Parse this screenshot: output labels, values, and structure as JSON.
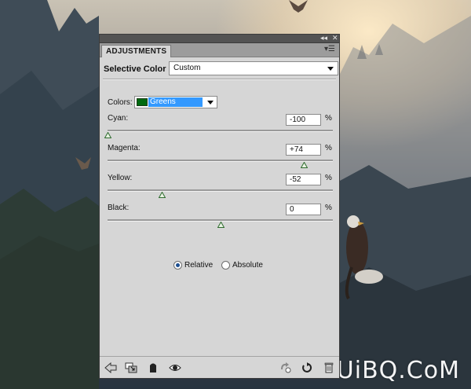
{
  "panel": {
    "tab_label": "ADJUSTMENTS",
    "adjustment_name": "Selective Color",
    "preset_value": "Custom",
    "colors_label": "Colors:",
    "colors_value": "Greens",
    "colors_swatch": "#006a10",
    "percent_symbol": "%",
    "sliders": [
      {
        "label": "Cyan:",
        "value": "-100",
        "level": -100
      },
      {
        "label": "Magenta:",
        "value": "+74",
        "level": 74
      },
      {
        "label": "Yellow:",
        "value": "-52",
        "level": -52
      },
      {
        "label": "Black:",
        "value": "0",
        "level": 0
      }
    ],
    "radio_relative": "Relative",
    "radio_absolute": "Absolute",
    "selected_method": "Relative",
    "footer_icons": [
      "back-arrow-icon",
      "clip-to-layer-icon",
      "mask-visibility-icon",
      "eye-icon",
      "view-previous-icon",
      "reset-icon",
      "trash-icon"
    ]
  },
  "watermark": "UiBQ.CoM",
  "colors": {
    "thumb_fill": "#e8f2e2",
    "thumb_stroke": "#2e6b2e",
    "selection_highlight": "#3399ff"
  }
}
